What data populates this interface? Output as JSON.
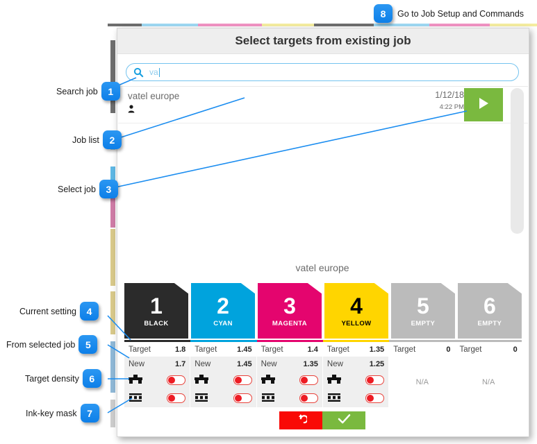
{
  "annotations": {
    "top": {
      "num": "8",
      "label": "Go to Job Setup and Commands"
    },
    "left": [
      {
        "num": "1",
        "label": "Search job"
      },
      {
        "num": "2",
        "label": "Job list"
      },
      {
        "num": "3",
        "label": "Select job"
      },
      {
        "num": "4",
        "label": "Current setting"
      },
      {
        "num": "5",
        "label": "From selected job"
      },
      {
        "num": "6",
        "label": "Target density"
      },
      {
        "num": "7",
        "label": "Ink-key mask"
      }
    ]
  },
  "dialog": {
    "title": "Select targets from existing job",
    "search": {
      "value": "va",
      "placeholder": "",
      "icon": "search-icon"
    },
    "job_list": [
      {
        "name": "vatel europe",
        "date": "1/12/18",
        "time": "4:22 PM",
        "user_icon": "user-icon",
        "play_icon": "play-icon"
      }
    ],
    "section_title": "vatel europe",
    "row_labels": {
      "target": "Target",
      "new": "New",
      "na": "N/A"
    },
    "units": [
      {
        "num": "1",
        "name": "BLACK",
        "color": "#2b2b2b",
        "text_color": "#ffffff",
        "target": "1.8",
        "new": "1.7",
        "density_on": true,
        "mask_on": true,
        "empty": false
      },
      {
        "num": "2",
        "name": "CYAN",
        "color": "#00a3dd",
        "text_color": "#ffffff",
        "target": "1.45",
        "new": "1.45",
        "density_on": true,
        "mask_on": true,
        "empty": false
      },
      {
        "num": "3",
        "name": "MAGENTA",
        "color": "#e4056e",
        "text_color": "#ffffff",
        "target": "1.4",
        "new": "1.35",
        "density_on": true,
        "mask_on": true,
        "empty": false
      },
      {
        "num": "4",
        "name": "YELLOW",
        "color": "#ffd500",
        "text_color": "#000000",
        "target": "1.35",
        "new": "1.25",
        "density_on": true,
        "mask_on": true,
        "empty": false
      },
      {
        "num": "5",
        "name": "EMPTY",
        "color": "#bbbbbb",
        "text_color": "#ffffff",
        "target": "0",
        "new": "",
        "density_on": false,
        "mask_on": false,
        "empty": true
      },
      {
        "num": "6",
        "name": "EMPTY",
        "color": "#bbbbbb",
        "text_color": "#ffffff",
        "target": "0",
        "new": "",
        "density_on": false,
        "mask_on": false,
        "empty": true
      }
    ],
    "footer": {
      "cancel": {
        "icon": "undo-icon",
        "color": "#f90a06"
      },
      "confirm": {
        "icon": "check-icon",
        "color": "#7ab93f"
      }
    }
  },
  "background": {
    "cmyk_strip": [
      "#6e6e6e",
      "#9ed8f2",
      "#f193c3",
      "#f5eda0",
      "#6e6e6e",
      "#9ed8f2",
      "#f193c3",
      "#f5eda0"
    ],
    "side_strips": [
      "#6e6e6e",
      "#9ed8f2",
      "#cf7ca6",
      "#d8c98a",
      "#8fb8d6"
    ]
  },
  "colors": {
    "accent_blue": "#1b8df0",
    "green": "#7ab93f",
    "red": "#ed1c24"
  }
}
